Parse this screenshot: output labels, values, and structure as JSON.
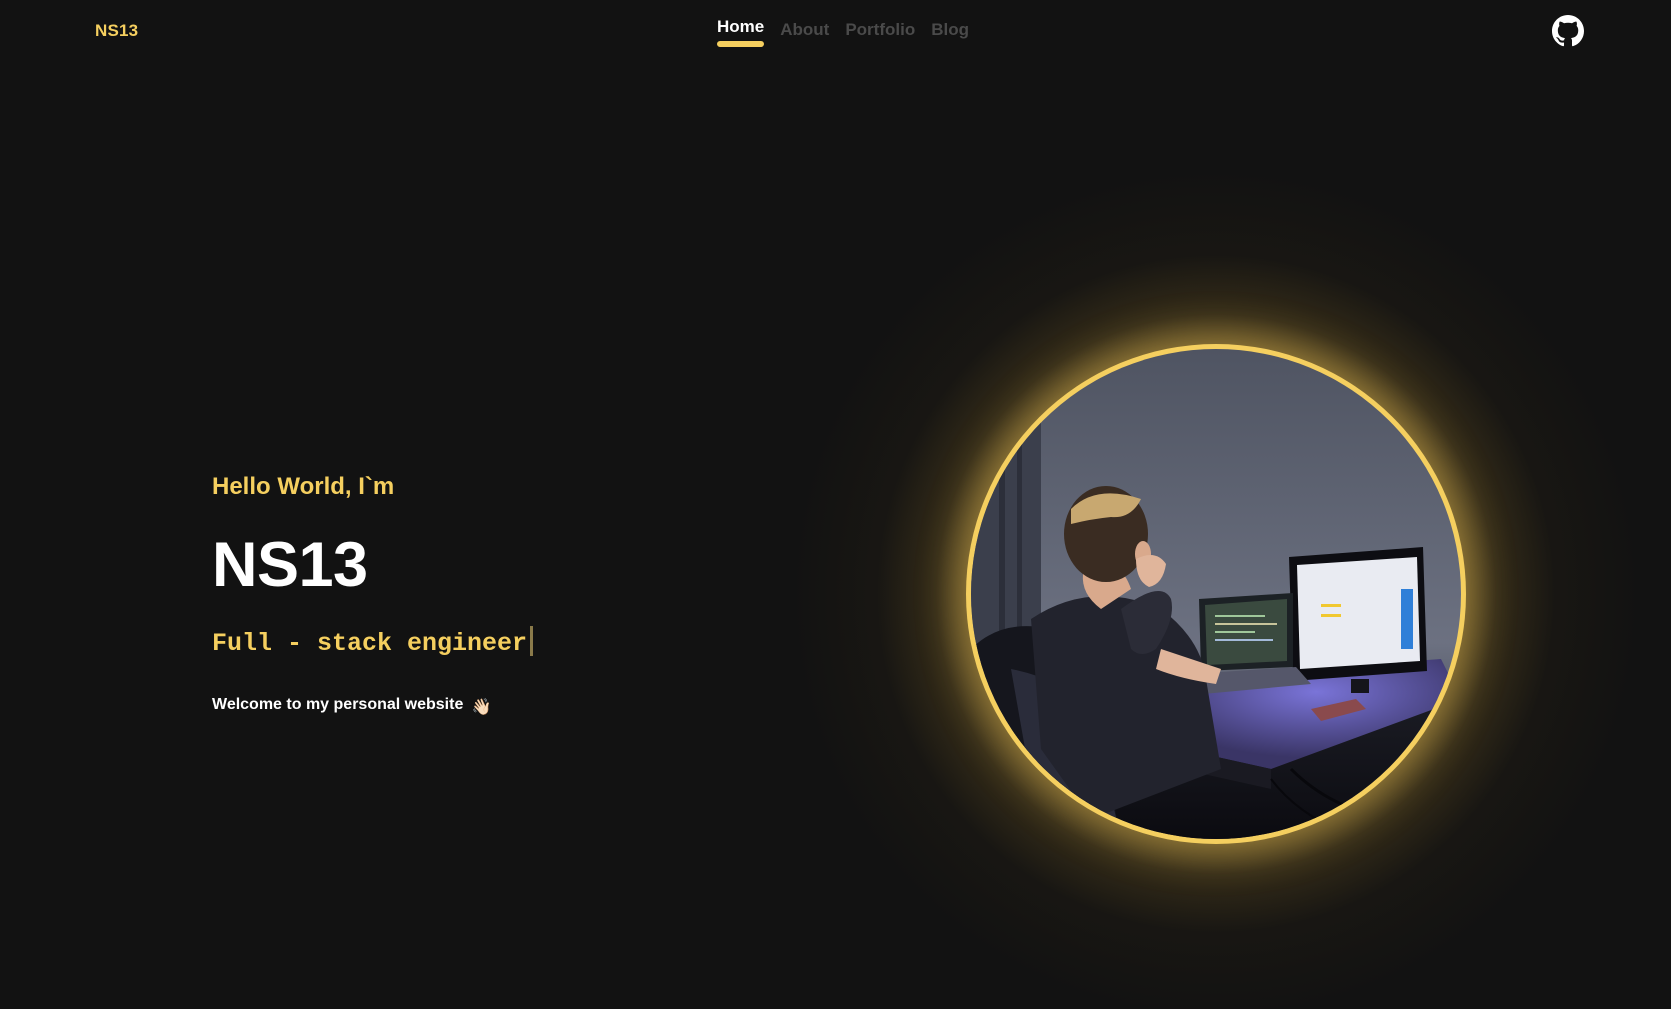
{
  "nav": {
    "brand": "NS13",
    "links": [
      {
        "label": "Home",
        "active": true
      },
      {
        "label": "About",
        "active": false
      },
      {
        "label": "Portfolio",
        "active": false
      },
      {
        "label": "Blog",
        "active": false
      }
    ],
    "github_icon": "github-icon"
  },
  "hero": {
    "greeting": "Hello World, I`m",
    "name": "NS13",
    "role": "Full - stack engineer",
    "welcome": "Welcome to my personal website",
    "welcome_emoji": "👋🏻"
  },
  "photo": {
    "ring_color": "#f5cf5f"
  },
  "colors": {
    "background": "#121212",
    "accent": "#f5cf5f",
    "nav_inactive": "#4a4a4a",
    "text": "#ffffff"
  }
}
